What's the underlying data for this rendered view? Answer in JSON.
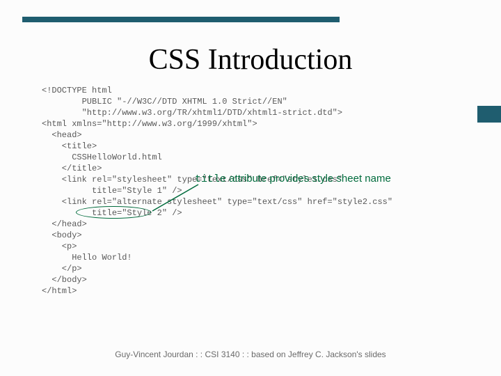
{
  "slide": {
    "title": "CSS Introduction",
    "footer": "Guy-Vincent Jourdan : : CSI 3140 : : based on Jeffrey C. Jackson's slides"
  },
  "annotation": {
    "mono": "title",
    "rest": " attribute provides style sheet name"
  },
  "code": {
    "l1": "<!DOCTYPE html",
    "l2": "        PUBLIC \"-//W3C//DTD XHTML 1.0 Strict//EN\"",
    "l3": "        \"http://www.w3.org/TR/xhtml1/DTD/xhtml1-strict.dtd\">",
    "l4": "<html xmlns=\"http://www.w3.org/1999/xhtml\">",
    "l5": "  <head>",
    "l6": "    <title>",
    "l7": "      CSSHelloWorld.html",
    "l8": "    </title>",
    "l9": "    <link rel=\"stylesheet\" type=\"text/css\" href=\"style1.css\"",
    "l10": "          title=\"Style 1\" />",
    "l11": "    <link rel=\"alternate stylesheet\" type=\"text/css\" href=\"style2.css\"",
    "l12": "          title=\"Style 2\" />",
    "l13": "  </head>",
    "l14": "  <body>",
    "l15": "    <p>",
    "l16": "      Hello World!",
    "l17": "    </p>",
    "l18": "  </body>",
    "l19": "</html>"
  }
}
